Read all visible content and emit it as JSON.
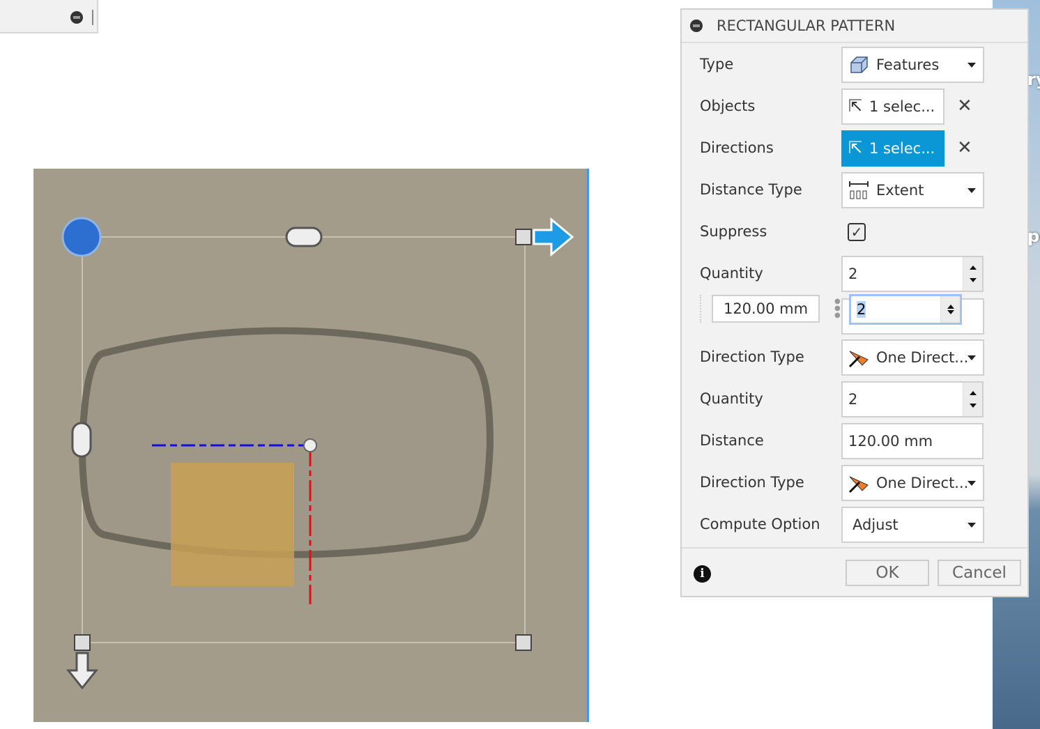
{
  "background": {
    "fragments": [
      "ry",
      "pe"
    ]
  },
  "dialog": {
    "title": "RECTANGULAR PATTERN",
    "rows": {
      "type": {
        "label": "Type",
        "value": "Features"
      },
      "objects": {
        "label": "Objects",
        "value": "1 selec..."
      },
      "directions": {
        "label": "Directions",
        "value": "1 selec..."
      },
      "distance_type": {
        "label": "Distance Type",
        "value": "Extent"
      },
      "suppress": {
        "label": "Suppress",
        "checked": true
      },
      "quantity1": {
        "label": "Quantity",
        "value": "2"
      },
      "inline_distance": "120.00 mm",
      "inline_quantity": "2",
      "direction_type1": {
        "label": "Direction Type",
        "value": "One Direct..."
      },
      "quantity2": {
        "label": "Quantity",
        "value": "2"
      },
      "distance": {
        "label": "Distance",
        "value": "120.00 mm"
      },
      "direction_type2": {
        "label": "Direction Type",
        "value": "One Direct..."
      },
      "compute_option": {
        "label": "Compute Option",
        "value": "Adjust"
      }
    },
    "ok": "OK",
    "cancel": "Cancel"
  },
  "colors": {
    "accent": "#0b96d6",
    "viewport": "#a39c8b"
  }
}
